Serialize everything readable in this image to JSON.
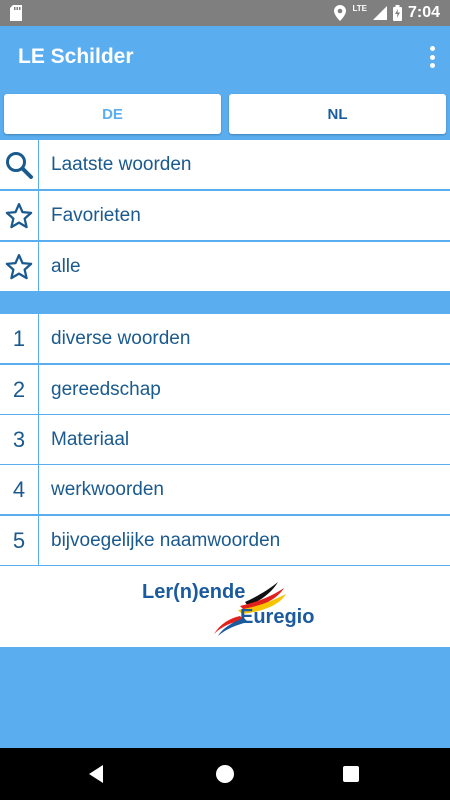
{
  "status_bar": {
    "network": "LTE",
    "time": "7:04"
  },
  "app_bar": {
    "title": "LE Schilder",
    "overflow_icon": "more-vert-icon"
  },
  "language_tabs": [
    {
      "label": "DE",
      "selected": true
    },
    {
      "label": "NL",
      "selected": false
    }
  ],
  "menu_items": [
    {
      "icon": "search-icon",
      "label": "Laatste woorden"
    },
    {
      "icon": "star-outline-icon",
      "label": "Favorieten"
    },
    {
      "icon": "star-outline-icon",
      "label": "alle"
    }
  ],
  "categories": [
    {
      "number": "1",
      "label": "diverse woorden"
    },
    {
      "number": "2",
      "label": "gereedschap"
    },
    {
      "number": "3",
      "label": "Materiaal"
    },
    {
      "number": "4",
      "label": "werkwoorden"
    },
    {
      "number": "5",
      "label": "bijvoegelijke naamwoorden"
    }
  ],
  "logo": {
    "line1": "Ler(n)ende",
    "line2": "Euregio"
  },
  "colors": {
    "primary": "#5aaef0",
    "text": "#1a5a8e",
    "status_bar": "#7f7f7f"
  }
}
